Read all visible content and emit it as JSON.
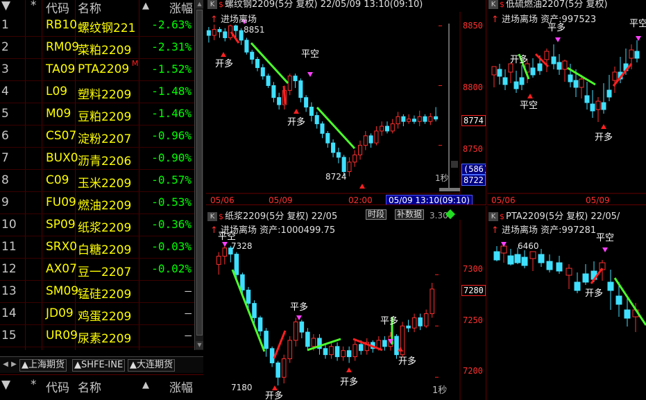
{
  "watchlist": {
    "header": {
      "idx": "▼",
      "star": "*",
      "code": "代码",
      "name": "名称",
      "sort": "▲",
      "chg": "涨幅"
    },
    "rows": [
      {
        "idx": "1",
        "code": "RB10",
        "name": "螺纹钢221",
        "chg": "-2.63%",
        "color": "#00ff00"
      },
      {
        "idx": "2",
        "code": "RM09",
        "name": "菜粕2209",
        "chg": "-2.31%",
        "color": "#00ff00"
      },
      {
        "idx": "3",
        "code": "TA09",
        "name": "PTA2209",
        "chg": "-1.52%",
        "color": "#00ff00",
        "flag": "M"
      },
      {
        "idx": "4",
        "code": "L09",
        "name": "塑料2209",
        "chg": "-1.48%",
        "color": "#00ff00"
      },
      {
        "idx": "5",
        "code": "M09",
        "name": "豆粕2209",
        "chg": "-1.46%",
        "color": "#00ff00"
      },
      {
        "idx": "6",
        "code": "CS07",
        "name": "淀粉2207",
        "chg": "-0.96%",
        "color": "#00ff00"
      },
      {
        "idx": "7",
        "code": "BUX0",
        "name": "沥青2206",
        "chg": "-0.90%",
        "color": "#00ff00"
      },
      {
        "idx": "8",
        "code": "C09",
        "name": "玉米2209",
        "chg": "-0.57%",
        "color": "#00ff00"
      },
      {
        "idx": "9",
        "code": "FU09",
        "name": "燃油2209",
        "chg": "-0.53%",
        "color": "#00ff00"
      },
      {
        "idx": "10",
        "code": "SP09",
        "name": "纸浆2209",
        "chg": "-0.36%",
        "color": "#00ff00"
      },
      {
        "idx": "11",
        "code": "SRX0",
        "name": "白糖2209",
        "chg": "-0.03%",
        "color": "#00ff00"
      },
      {
        "idx": "12",
        "code": "AX07",
        "name": "豆一2207",
        "chg": "-0.02%",
        "color": "#00ff00"
      },
      {
        "idx": "13",
        "code": "SM09",
        "name": "锰硅2209",
        "chg": "—",
        "color": "#c8c8c8"
      },
      {
        "idx": "14",
        "code": "JD09",
        "name": "鸡蛋2209",
        "chg": "—",
        "color": "#c8c8c8"
      },
      {
        "idx": "15",
        "code": "UR09",
        "name": "尿素2209",
        "chg": "—",
        "color": "#c8c8c8"
      }
    ],
    "tabs": [
      "▲上海期货",
      "▲SHFE-INE",
      "▲大连期货"
    ],
    "header2": {
      "idx": "▼",
      "star": "*",
      "code": "代码",
      "name": "名称",
      "sort": "▲",
      "chg": "涨幅"
    }
  },
  "panels": {
    "p1": {
      "title": "螺纹钢2209(5分 复权) 22/05/09 13:10(09:10)",
      "k_label": "K",
      "s_label": "$",
      "subtitle": "进场离场",
      "prices": [
        "8850",
        "8800",
        "8774",
        "8750"
      ],
      "last_price": "8774",
      "hi_note": "8851",
      "lo_note": "8724",
      "dates": [
        "05/06",
        "05/09",
        "02:00"
      ],
      "time_box": "05/09 13:10(09:10)",
      "box1": "(586)",
      "box2": "8722",
      "period": "1秒",
      "signals": [
        "开多",
        "平空",
        "开多",
        "平空"
      ]
    },
    "p2": {
      "title": "低硫燃油2207(5分 复权)",
      "k_label": "K",
      "s_label": "$",
      "subtitle": "进场离场 资产:997523",
      "dates": [
        "05/06",
        "05/09"
      ],
      "signals": [
        "平空",
        "开多",
        "平多",
        "开多",
        "平空"
      ]
    },
    "p3": {
      "title": "纸浆2209(5分 复权) 22/05",
      "k_label": "K",
      "s_label": "$",
      "btn_period": "时段",
      "btn_data": "补数据",
      "btn_extra": "3.30",
      "subtitle": "进场离场 资产:1000499.75",
      "prices": [
        "7300",
        "7280",
        "7250",
        "7200"
      ],
      "last_price": "7280",
      "hi_note": "7328",
      "lo_note": "7180",
      "period": "1秒",
      "signals": [
        "平空",
        "平多",
        "开多",
        "开多",
        "平多",
        "开多"
      ]
    },
    "p4": {
      "title": "PTA2209(5分 复权) 22/05/",
      "k_label": "K",
      "s_label": "$",
      "subtitle": "进场离场 资产:997281",
      "hi_note": "6460",
      "signals": [
        "平空",
        "开多"
      ]
    }
  },
  "chart_data": [
    {
      "type": "candlestick",
      "title": "螺纹钢2209(5分 复权)",
      "ylim": [
        8715,
        8860
      ],
      "y_ticks": [
        8750,
        8800,
        8850
      ],
      "candles": [
        [
          8846,
          8842,
          8849,
          8836
        ],
        [
          8842,
          8847,
          8851,
          8838
        ],
        [
          8847,
          8845,
          8849,
          8840
        ],
        [
          8845,
          8840,
          8848,
          8837
        ],
        [
          8840,
          8850,
          8851,
          8838
        ],
        [
          8850,
          8846,
          8851,
          8840
        ],
        [
          8846,
          8838,
          8848,
          8834
        ],
        [
          8838,
          8828,
          8840,
          8826
        ],
        [
          8828,
          8822,
          8830,
          8818
        ],
        [
          8822,
          8815,
          8824,
          8812
        ],
        [
          8815,
          8808,
          8818,
          8805
        ],
        [
          8808,
          8800,
          8810,
          8798
        ],
        [
          8800,
          8790,
          8803,
          8786
        ],
        [
          8790,
          8784,
          8794,
          8780
        ],
        [
          8784,
          8796,
          8800,
          8780
        ],
        [
          8796,
          8808,
          8810,
          8792
        ],
        [
          8808,
          8804,
          8810,
          8798
        ],
        [
          8804,
          8790,
          8806,
          8786
        ],
        [
          8790,
          8782,
          8792,
          8778
        ],
        [
          8782,
          8775,
          8786,
          8770
        ],
        [
          8775,
          8768,
          8778,
          8764
        ],
        [
          8768,
          8760,
          8770,
          8756
        ],
        [
          8760,
          8752,
          8762,
          8748
        ],
        [
          8752,
          8744,
          8755,
          8740
        ],
        [
          8744,
          8740,
          8748,
          8735
        ],
        [
          8740,
          8728,
          8742,
          8724
        ],
        [
          8728,
          8736,
          8740,
          8724
        ],
        [
          8736,
          8742,
          8746,
          8732
        ],
        [
          8742,
          8750,
          8754,
          8738
        ],
        [
          8750,
          8758,
          8762,
          8746
        ],
        [
          8758,
          8752,
          8760,
          8748
        ],
        [
          8752,
          8762,
          8766,
          8750
        ],
        [
          8762,
          8766,
          8770,
          8758
        ],
        [
          8766,
          8762,
          8770,
          8760
        ],
        [
          8762,
          8768,
          8772,
          8760
        ],
        [
          8768,
          8774,
          8778,
          8764
        ],
        [
          8774,
          8770,
          8776,
          8766
        ],
        [
          8770,
          8772,
          8776,
          8768
        ],
        [
          8772,
          8770,
          8775,
          8768
        ],
        [
          8770,
          8774,
          8779,
          8766
        ],
        [
          8774,
          8770,
          8776,
          8768
        ],
        [
          8770,
          8774,
          8777,
          8767
        ],
        [
          8774,
          8772,
          8782,
          8770
        ]
      ]
    },
    {
      "type": "candlestick",
      "title": "纸浆2209(5分 复权)",
      "ylim": [
        7190,
        7340
      ],
      "y_ticks": [
        7200,
        7250,
        7300
      ],
      "candles": [
        [
          7310,
          7318,
          7322,
          7300
        ],
        [
          7318,
          7326,
          7330,
          7310
        ],
        [
          7326,
          7320,
          7328,
          7312
        ],
        [
          7320,
          7300,
          7322,
          7296
        ],
        [
          7300,
          7285,
          7302,
          7280
        ],
        [
          7285,
          7272,
          7288,
          7266
        ],
        [
          7272,
          7258,
          7275,
          7250
        ],
        [
          7258,
          7245,
          7260,
          7240
        ],
        [
          7245,
          7228,
          7248,
          7220
        ],
        [
          7228,
          7214,
          7230,
          7210
        ],
        [
          7214,
          7200,
          7216,
          7192
        ],
        [
          7200,
          7218,
          7222,
          7194
        ],
        [
          7218,
          7236,
          7240,
          7214
        ],
        [
          7236,
          7254,
          7258,
          7230
        ],
        [
          7254,
          7244,
          7256,
          7238
        ],
        [
          7244,
          7230,
          7248,
          7226
        ],
        [
          7230,
          7238,
          7242,
          7226
        ],
        [
          7238,
          7228,
          7242,
          7222
        ],
        [
          7228,
          7222,
          7232,
          7218
        ],
        [
          7222,
          7230,
          7234,
          7218
        ],
        [
          7230,
          7220,
          7234,
          7216
        ],
        [
          7220,
          7226,
          7230,
          7216
        ],
        [
          7226,
          7220,
          7230,
          7214
        ],
        [
          7220,
          7232,
          7236,
          7216
        ],
        [
          7232,
          7226,
          7236,
          7222
        ],
        [
          7226,
          7234,
          7238,
          7222
        ],
        [
          7234,
          7228,
          7236,
          7224
        ],
        [
          7228,
          7236,
          7240,
          7226
        ],
        [
          7236,
          7230,
          7240,
          7226
        ],
        [
          7230,
          7240,
          7244,
          7226
        ],
        [
          7240,
          7222,
          7242,
          7218
        ],
        [
          7222,
          7250,
          7254,
          7220
        ],
        [
          7250,
          7248,
          7256,
          7244
        ],
        [
          7248,
          7258,
          7262,
          7244
        ],
        [
          7258,
          7250,
          7262,
          7246
        ],
        [
          7250,
          7262,
          7266,
          7248
        ],
        [
          7262,
          7286,
          7292,
          7258
        ]
      ]
    }
  ]
}
